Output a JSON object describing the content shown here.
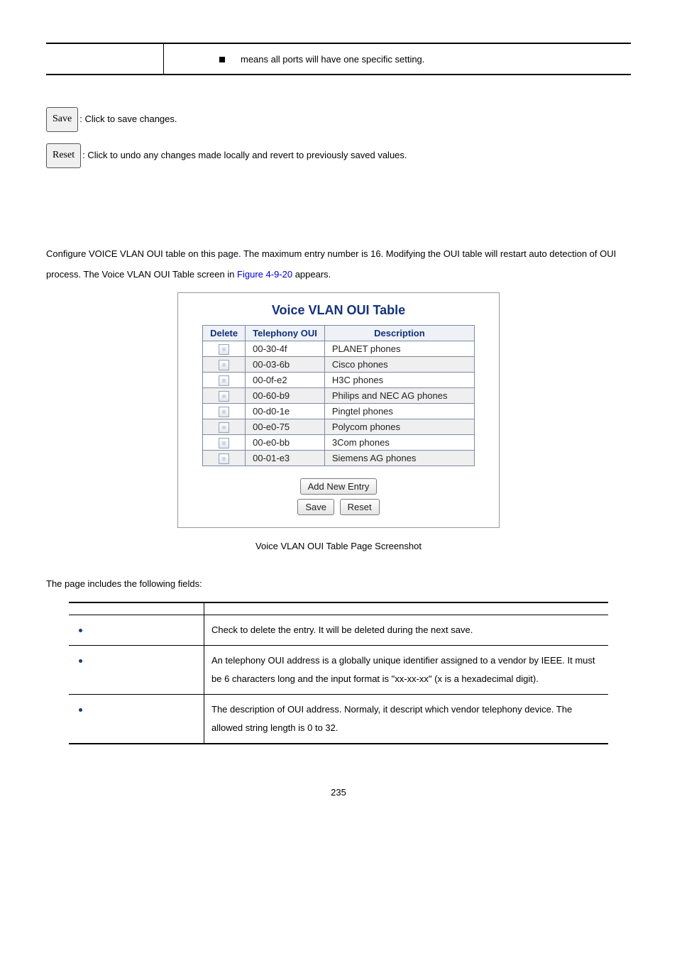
{
  "top_note": "means all ports will have one specific setting.",
  "buttons": {
    "save_label": "Save",
    "save_desc": ": Click to save changes.",
    "reset_label": "Reset",
    "reset_desc": ": Click to undo any changes made locally and revert to previously saved values."
  },
  "para1_a": "Configure VOICE VLAN OUI table on this page. The maximum entry number is 16. Modifying the OUI table will restart auto detection of OUI process. The Voice VLAN OUI Table screen in ",
  "para1_link": "Figure 4-9-20",
  "para1_b": " appears.",
  "figure": {
    "title": "Voice VLAN OUI Table",
    "headers": {
      "del": "Delete",
      "oui": "Telephony OUI",
      "desc": "Description"
    },
    "rows": [
      {
        "oui": "00-30-4f",
        "desc": "PLANET phones",
        "alt": false
      },
      {
        "oui": "00-03-6b",
        "desc": "Cisco phones",
        "alt": true
      },
      {
        "oui": "00-0f-e2",
        "desc": "H3C phones",
        "alt": false
      },
      {
        "oui": "00-60-b9",
        "desc": "Philips and NEC AG phones",
        "alt": true
      },
      {
        "oui": "00-d0-1e",
        "desc": "Pingtel phones",
        "alt": false
      },
      {
        "oui": "00-e0-75",
        "desc": "Polycom phones",
        "alt": true
      },
      {
        "oui": "00-e0-bb",
        "desc": "3Com phones",
        "alt": false
      },
      {
        "oui": "00-01-e3",
        "desc": "Siemens AG phones",
        "alt": true
      }
    ],
    "add_btn": "Add New Entry",
    "save_btn": "Save",
    "reset_btn": "Reset",
    "caption": "Voice VLAN OUI Table Page Screenshot"
  },
  "fields_intro": "The page includes the following fields:",
  "fields_table": {
    "header_obj": "",
    "header_desc": "",
    "rows": [
      {
        "obj": "",
        "desc": "Check to delete the entry. It will be deleted during the next save."
      },
      {
        "obj": "",
        "desc": "An telephony OUI address is a globally unique identifier assigned to a vendor by IEEE. It must be 6 characters long and the input format is \"xx-xx-xx\" (x is a hexadecimal digit)."
      },
      {
        "obj": "",
        "desc": "The description of OUI address. Normaly, it descript which vendor telephony device. The allowed string length is 0 to 32."
      }
    ]
  },
  "page_number": "235"
}
